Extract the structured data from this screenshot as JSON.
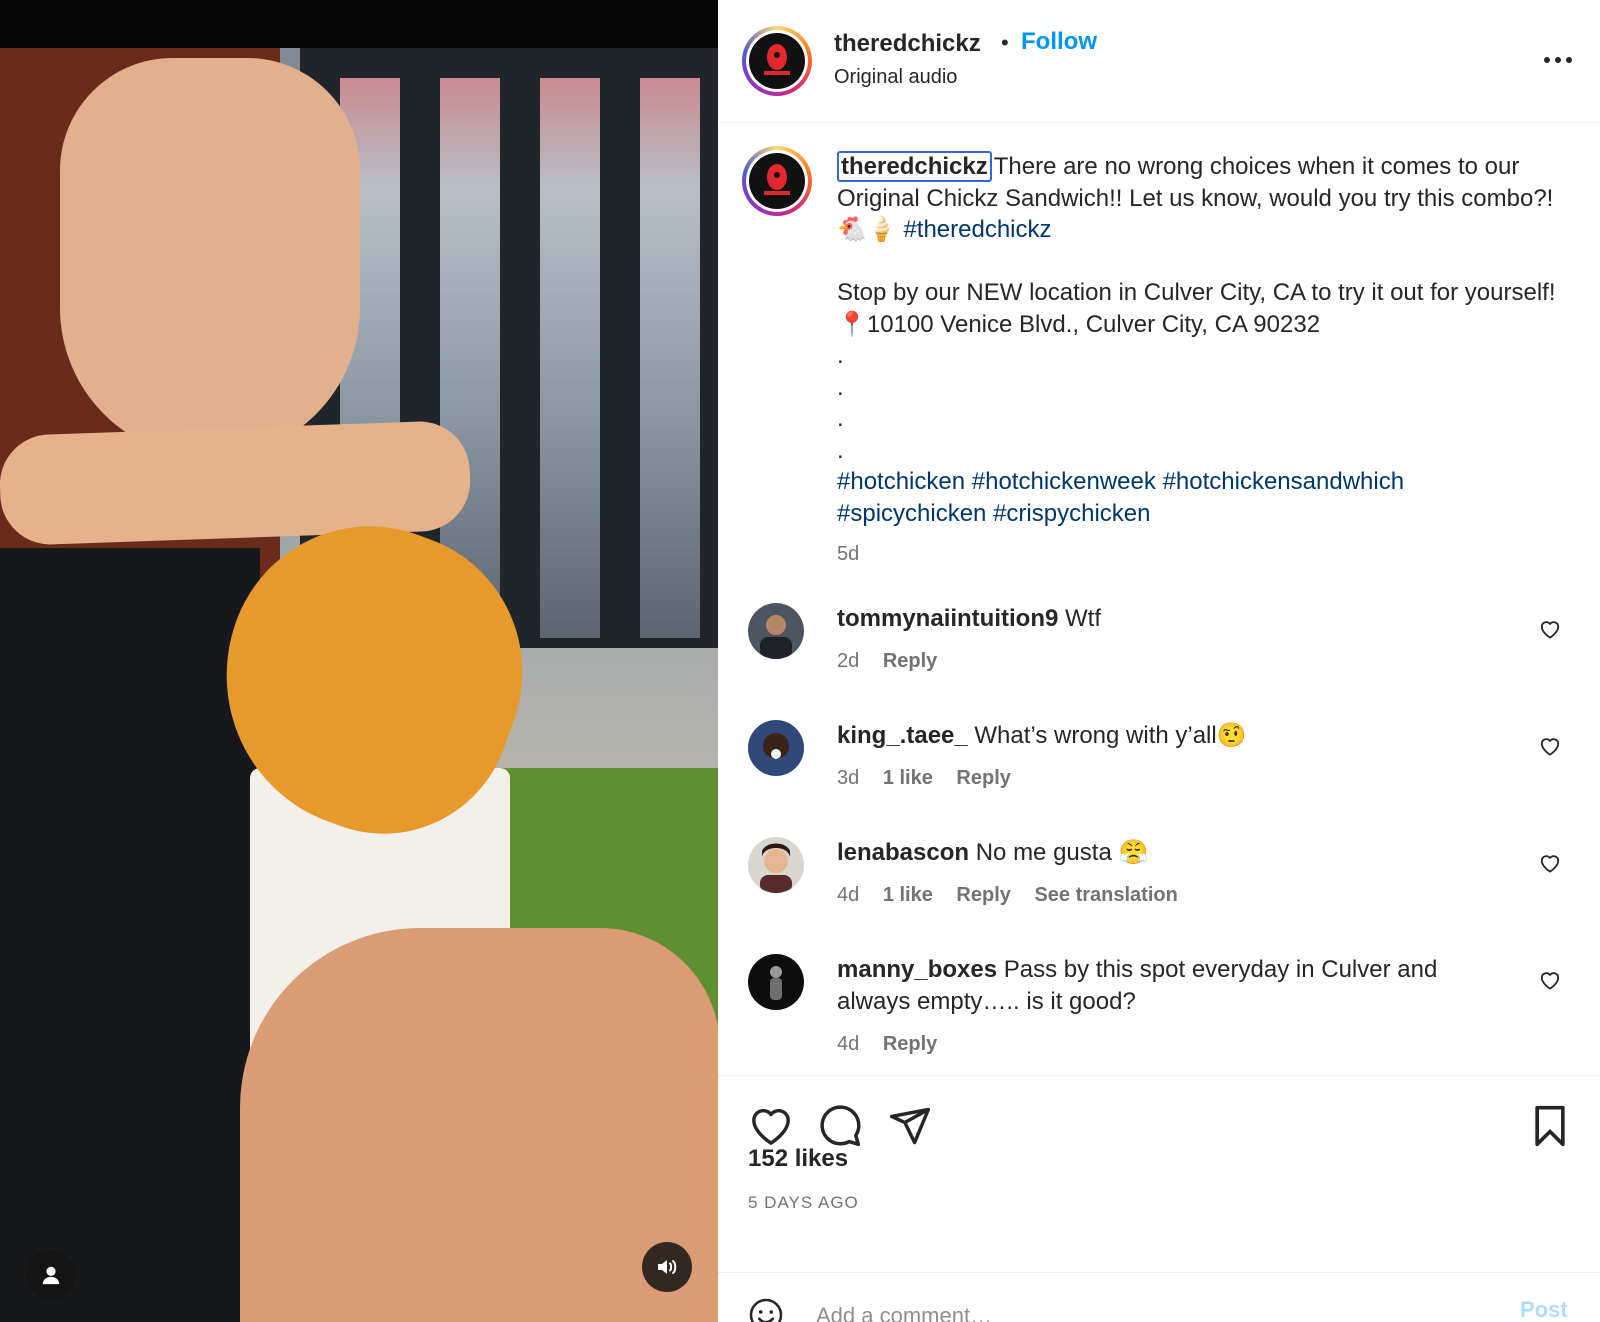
{
  "post": {
    "username": "theredchickz",
    "separator": "•",
    "follow_label": "Follow",
    "audio_label": "Original audio",
    "more_icon": "more-horizontal-icon"
  },
  "caption": {
    "username": "theredchickz",
    "line1": "There are no wrong choices when it comes to our Original Chickz Sandwich!! Let us know, would you try this combo?! 🐔🍦",
    "hashtag1": "#theredchickz",
    "line2": "Stop by our NEW location in Culver City, CA to try it out for yourself! 📍10100 Venice Blvd., Culver City, CA 90232",
    "dots": ".",
    "hashtags": [
      "#hotchicken",
      "#hotchickenweek",
      "#hotchickensandwhich",
      "#spicychicken",
      "#crispychicken"
    ],
    "age": "5d"
  },
  "comments": [
    {
      "username": "tommynaiintuition9",
      "text": "Wtf",
      "age": "2d",
      "likes": "",
      "reply": "Reply",
      "translate": ""
    },
    {
      "username": "king_.taee_",
      "text": "What’s wrong with y’all🤨",
      "age": "3d",
      "likes": "1 like",
      "reply": "Reply",
      "translate": ""
    },
    {
      "username": "lenabascon",
      "text": "No me gusta 😤",
      "age": "4d",
      "likes": "1 like",
      "reply": "Reply",
      "translate": "See translation"
    },
    {
      "username": "manny_boxes",
      "text": "Pass by this spot everyday in Culver and always empty….. is it good?",
      "age": "4d",
      "likes": "",
      "reply": "Reply",
      "translate": ""
    }
  ],
  "actions": {
    "icons": [
      "heart-icon",
      "comment-icon",
      "share-icon",
      "bookmark-icon"
    ],
    "likes_label": "152 likes",
    "date_label": "5 DAYS AGO"
  },
  "composer": {
    "placeholder": "Add a comment…",
    "post_label": "Post"
  },
  "media": {
    "user_tag_icon": "user-icon",
    "audio_icon": "speaker-icon"
  },
  "colors": {
    "link_blue": "#0095f6",
    "hashtag_blue": "#00376b",
    "muted": "#737373"
  }
}
